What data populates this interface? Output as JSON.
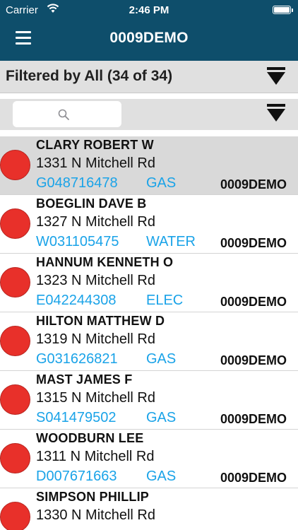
{
  "status_bar": {
    "carrier": "Carrier",
    "time": "2:46 PM",
    "wifi_icon": "wifi-icon",
    "battery_icon": "battery-full-icon"
  },
  "nav": {
    "menu_icon": "hamburger-menu-icon",
    "title": "0009DEMO",
    "background": "#0e4e6b"
  },
  "filter": {
    "label": "Filtered by All (34 of 34)",
    "icon": "filter-funnel-icon"
  },
  "search": {
    "placeholder": "",
    "value": "",
    "icon": "magnifier-icon",
    "sort_icon": "filter-funnel-icon"
  },
  "colors": {
    "status_dot": "#e8302a",
    "link_blue": "#1aa3e8",
    "selected_row": "#d9d9d9"
  },
  "list": [
    {
      "name": "CLARY ROBERT W",
      "address": "1331 N Mitchell Rd",
      "account": "G048716478",
      "service": "GAS",
      "route": "0009DEMO",
      "selected": true
    },
    {
      "name": "BOEGLIN DAVE B",
      "address": "1327 N Mitchell Rd",
      "account": "W031105475",
      "service": "WATER",
      "route": "0009DEMO",
      "selected": false
    },
    {
      "name": "HANNUM KENNETH O",
      "address": "1323 N Mitchell Rd",
      "account": "E042244308",
      "service": "ELEC",
      "route": "0009DEMO",
      "selected": false
    },
    {
      "name": "HILTON MATTHEW D",
      "address": "1319 N Mitchell Rd",
      "account": "G031626821",
      "service": "GAS",
      "route": "0009DEMO",
      "selected": false
    },
    {
      "name": "MAST JAMES F",
      "address": "1315 N Mitchell Rd",
      "account": "S041479502",
      "service": "GAS",
      "route": "0009DEMO",
      "selected": false
    },
    {
      "name": "WOODBURN LEE",
      "address": "1311 N Mitchell Rd",
      "account": "D007671663",
      "service": "GAS",
      "route": "0009DEMO",
      "selected": false
    },
    {
      "name": "SIMPSON PHILLIP",
      "address": "1330 N Mitchell Rd",
      "account": "",
      "service": "",
      "route": "",
      "selected": false
    }
  ]
}
